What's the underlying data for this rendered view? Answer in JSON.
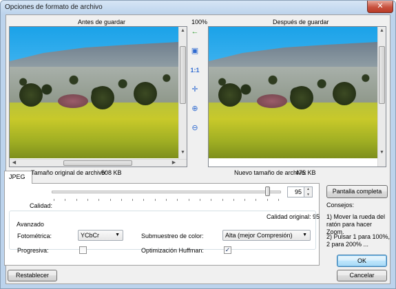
{
  "window": {
    "title": "Opciones de formato de archivo",
    "close_glyph": "✕"
  },
  "preview": {
    "before_label": "Antes de guardar",
    "zoom_label": "100%",
    "after_label": "Después de guardar",
    "original_size_label": "Tamaño original de archivo:",
    "original_size_value": "508 KB",
    "new_size_label": "Nuevo tamaño de archivo:",
    "new_size_value": "475 KB"
  },
  "toolbar": {
    "items": [
      {
        "name": "sync-arrow-icon",
        "glyph": "←"
      },
      {
        "name": "fit-window-icon",
        "glyph": "▣"
      },
      {
        "name": "actual-size-icon",
        "glyph": "1:1"
      },
      {
        "name": "center-icon",
        "glyph": "✛"
      },
      {
        "name": "zoom-in-icon",
        "glyph": "⊕"
      },
      {
        "name": "zoom-out-icon",
        "glyph": "⊖"
      }
    ],
    "colors": {
      "sync": "#2e9a2e",
      "tool": "#2f6ad0"
    }
  },
  "tabs": [
    {
      "label": "JPEG"
    }
  ],
  "quality": {
    "label": "Calidad:",
    "value": "95",
    "slider_fraction": 0.95,
    "original_label": "Calidad original: 95"
  },
  "advanced": {
    "legend": "Avanzado",
    "photometric_label": "Fotométrica:",
    "photometric_value": "YCbCr",
    "subsampling_label": "Submuestreo de color:",
    "subsampling_value": "Alta (mejor Compresión)",
    "progressive_label": "Progresiva:",
    "progressive_checked": false,
    "huffman_label": "Optimización Huffman:",
    "huffman_checked": true
  },
  "buttons": {
    "fullscreen": "Pantalla completa",
    "ok": "OK",
    "cancel": "Cancelar",
    "reset": "Restablecer"
  },
  "tips": {
    "title": "Consejos:",
    "tip1": "1) Mover la rueda del ratón para hacer Zoom.",
    "tip2": "2) Pulsar 1 para 100%, 2 para 200% ..."
  },
  "colors": {
    "accent": "#3c7fb1",
    "window_frame": "#bcd3ec"
  }
}
